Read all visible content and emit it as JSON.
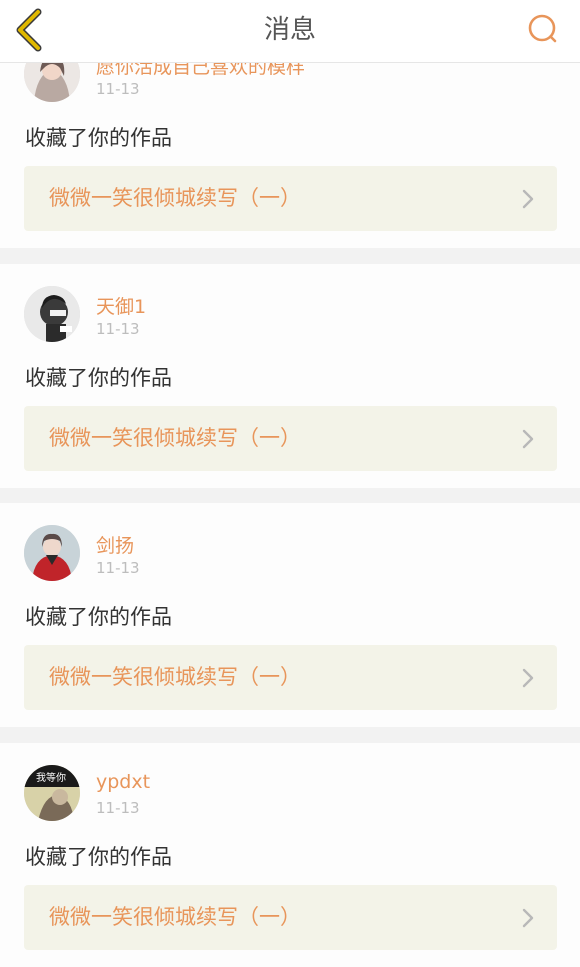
{
  "header": {
    "title": "消息"
  },
  "notifications": [
    {
      "username": "愿你活成自己喜欢的模样",
      "date": "11-13",
      "action": "收藏了你的作品",
      "work_title": "微微一笑很倾城续写（一）"
    },
    {
      "username": "天御1",
      "date": "11-13",
      "action": "收藏了你的作品",
      "work_title": "微微一笑很倾城续写（一）"
    },
    {
      "username": "剑扬",
      "date": "11-13",
      "action": "收藏了你的作品",
      "work_title": "微微一笑很倾城续写（一）"
    },
    {
      "username": "ypdxt",
      "date": "11-13",
      "action": "收藏了你的作品",
      "work_title": "微微一笑很倾城续写（一）",
      "avatar_text": "我等你"
    }
  ],
  "colors": {
    "accent": "#e8955a",
    "back_arrow": "#e0b800",
    "link_bg": "#f3f3e8"
  },
  "icons": {
    "back": "chevron-left-icon",
    "search": "search-icon",
    "link_arrow": "chevron-right-icon"
  }
}
